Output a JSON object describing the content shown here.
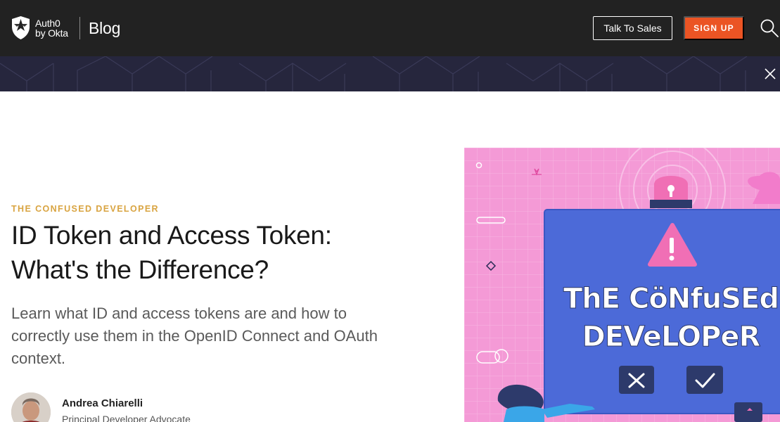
{
  "nav": {
    "logo_line1": "Auth0",
    "logo_line2": "by Okta",
    "blog_label": "Blog",
    "talk_to_sales": "Talk To Sales",
    "sign_up": "SIGN UP",
    "search_icon": "search-icon"
  },
  "banner": {
    "close_icon": "close-icon"
  },
  "article": {
    "category": "THE CONFUSED DEVELOPER",
    "title": "ID Token and Access Token: What's the Difference?",
    "subtitle": "Learn what ID and access tokens are and how to correctly use them in the OpenID Connect and OAuth context.",
    "author": {
      "name": "Andrea Chiarelli",
      "role": "Principal Developer Advocate"
    }
  },
  "hero": {
    "line1": "ThE CöNfuSEd",
    "line2": "DEVeLOPeR"
  },
  "colors": {
    "nav_bg": "#222222",
    "banner_bg": "#26263d",
    "accent": "#eb5424",
    "category": "#d9a441",
    "hero_pink": "#f49ad6",
    "hero_screen": "#4c6ad8"
  }
}
